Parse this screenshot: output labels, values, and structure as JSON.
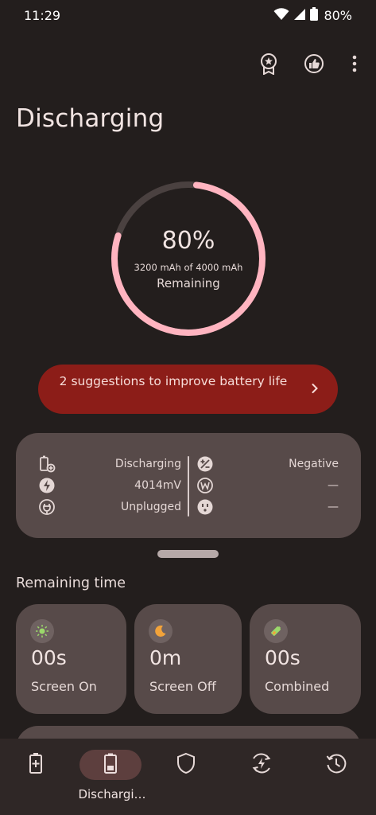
{
  "status_bar": {
    "time": "11:29",
    "battery_percent": "80%",
    "icons": [
      "wifi-icon",
      "cell-signal-icon",
      "battery-icon"
    ]
  },
  "action_bar": {
    "icons": [
      "award-badge-icon",
      "thumbs-up-icon",
      "more-vertical-icon"
    ]
  },
  "page": {
    "title": "Discharging"
  },
  "battery_ring": {
    "percent_text": "80%",
    "level_fraction": 0.8,
    "capacity_text": "3200 mAh of 4000 mAh",
    "remaining_label": "Remaining",
    "colors": {
      "progress": "#ffb4c0",
      "track": "#4a4140"
    }
  },
  "suggestions": {
    "label": "2 suggestions to improve battery life",
    "icon": "chevron-right-icon",
    "color": "#8c1d18"
  },
  "info_card": {
    "left": [
      {
        "icon": "battery-plus-icon",
        "value": "Discharging"
      },
      {
        "icon": "bolt-icon",
        "value": "4014mV"
      },
      {
        "icon": "plug-icon",
        "value": "Unplugged"
      }
    ],
    "right": [
      {
        "icon": "plus-minus-icon",
        "value": "Negative"
      },
      {
        "icon": "watt-icon",
        "value": "—"
      },
      {
        "icon": "outlet-icon",
        "value": "—"
      }
    ]
  },
  "remaining_time": {
    "title": "Remaining time",
    "cards": [
      {
        "icon": "sun-icon",
        "value": "00s",
        "label": "Screen On",
        "icon_color": "#9bd86b"
      },
      {
        "icon": "moon-icon",
        "value": "0m",
        "label": "Screen Off",
        "icon_color": "#f2a33a"
      },
      {
        "icon": "battery-leaf-icon",
        "value": "00s",
        "label": "Combined",
        "icon_color": "#9bd86b"
      }
    ]
  },
  "bottom_nav": {
    "items": [
      {
        "icon": "battery-charging-icon",
        "label": ""
      },
      {
        "icon": "battery-icon",
        "label": "Dischargi…",
        "active": true
      },
      {
        "icon": "shield-icon",
        "label": ""
      },
      {
        "icon": "bolt-cycle-icon",
        "label": ""
      },
      {
        "icon": "history-icon",
        "label": ""
      }
    ]
  }
}
